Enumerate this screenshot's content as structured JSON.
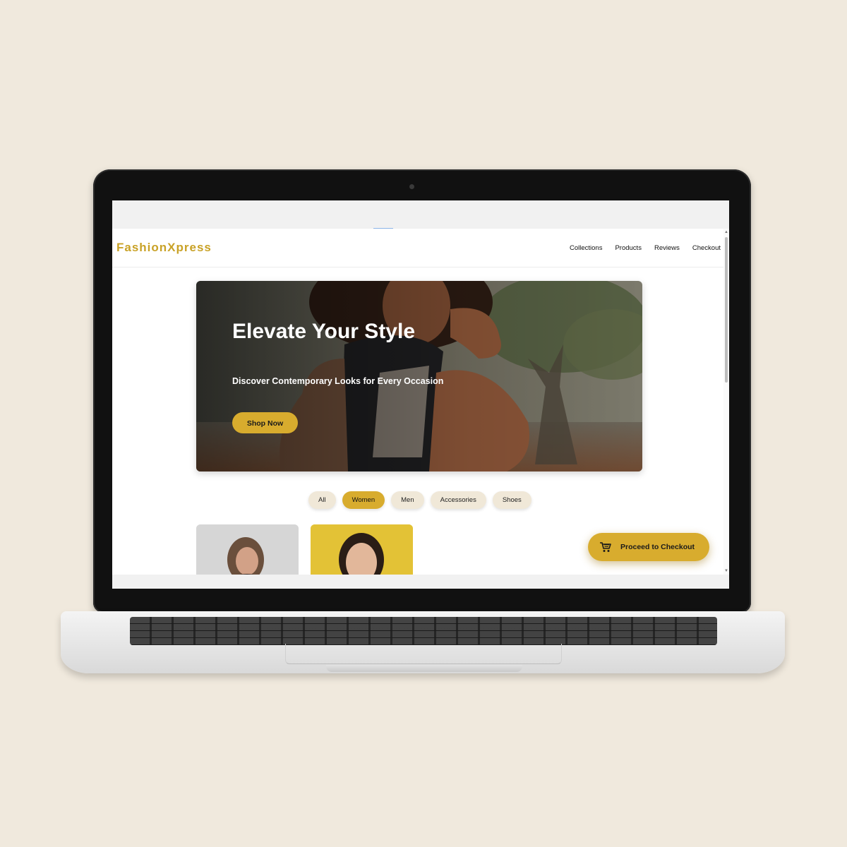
{
  "brand": {
    "name": "FashionXpress",
    "accent": "#d8ac2e",
    "logo_color": "#c9a227"
  },
  "nav": {
    "links": [
      "Collections",
      "Products",
      "Reviews",
      "Checkout"
    ]
  },
  "hero": {
    "title": "Elevate Your Style",
    "subtitle": "Discover Contemporary Looks for Every Occasion",
    "cta": "Shop Now"
  },
  "filters": {
    "items": [
      "All",
      "Women",
      "Men",
      "Accessories",
      "Shoes"
    ],
    "active": "Women"
  },
  "checkout": {
    "label": "Proceed to Checkout",
    "icon": "shopping-cart-icon"
  },
  "background_color": "#f0e9dd"
}
